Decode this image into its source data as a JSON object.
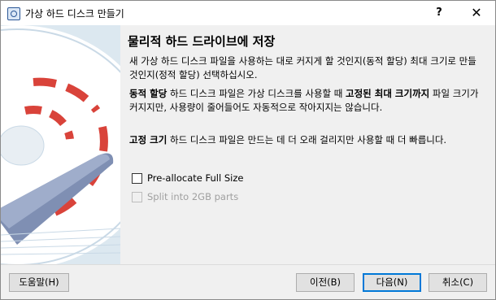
{
  "window": {
    "title": "가상 하드 디스크 만들기",
    "help_label": "?",
    "close_label": "✕"
  },
  "page": {
    "title": "물리적 하드 드라이브에 저장",
    "intro": "새 가상 하드 디스크 파일을 사용하는 대로 커지게 할 것인지(동적 할당) 최대 크기로 만들 것인지(정적 할당) 선택하십시오.",
    "dynamic": {
      "term": "동적 할당",
      "text_a": " 하드 디스크 파일은 가상 디스크를 사용할 때 ",
      "bold_b": "고정된 최대 크기까지",
      "text_c": " 파일 크기가 커지지만, 사용량이 줄어들어도 자동적으로 작아지지는 않습니다."
    },
    "fixed": {
      "term": "고정 크기",
      "text": " 하드 디스크 파일은 만드는 데 더 오래 걸리지만 사용할 때 더 빠릅니다."
    }
  },
  "options": {
    "preallocate": {
      "label": "Pre-allocate Full Size",
      "checked": false
    },
    "split": {
      "label": "Split into 2GB parts",
      "checked": false,
      "enabled": false
    }
  },
  "buttons": {
    "help": "도움말(H)",
    "back": "이전(B)",
    "next": "다음(N)",
    "cancel": "취소(C)"
  },
  "colors": {
    "accent": "#0078d7",
    "art_red": "#d9433a",
    "art_bg": "#dce8f0"
  }
}
